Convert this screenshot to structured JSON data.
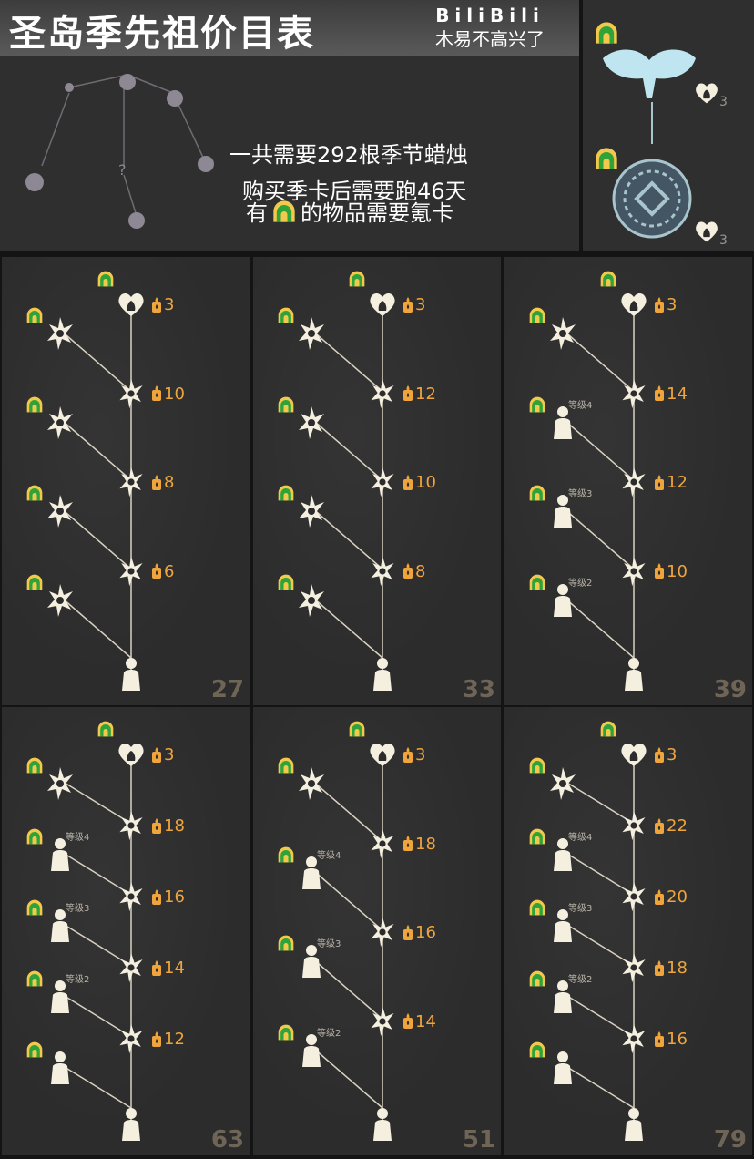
{
  "header": {
    "title": "圣岛季先祖价目表",
    "brand": "BiliBili",
    "author": "木易不高兴了",
    "total": "一共需要292根季节蜡烛",
    "days": "购买季卡后需要跑46天",
    "note_pre": "有",
    "note_post": "的物品需要氪卡"
  },
  "bonus": {
    "heart_cost_1": "3",
    "heart_cost_2": "3"
  },
  "colors": {
    "accent": "#f0a53c",
    "pass_green": "#2fa33a",
    "pass_gold": "#f2c94c"
  },
  "panels": [
    {
      "total": "27",
      "costs": [
        "3",
        "10",
        "8",
        "6"
      ]
    },
    {
      "total": "33",
      "costs": [
        "3",
        "12",
        "10",
        "8"
      ]
    },
    {
      "total": "39",
      "costs": [
        "3",
        "14",
        "12",
        "10"
      ],
      "levels": [
        "等级4",
        "等级3",
        "等级2"
      ]
    },
    {
      "total": "63",
      "costs": [
        "3",
        "18",
        "16",
        "14",
        "12"
      ],
      "levels": [
        "等级4",
        "等级3",
        "等级2"
      ]
    },
    {
      "total": "51",
      "costs": [
        "3",
        "18",
        "16",
        "14"
      ],
      "levels": [
        "等级4",
        "等级3",
        "等级2"
      ]
    },
    {
      "total": "79",
      "costs": [
        "3",
        "22",
        "20",
        "18",
        "16"
      ],
      "levels": [
        "等级4",
        "等级3",
        "等级2"
      ]
    }
  ]
}
